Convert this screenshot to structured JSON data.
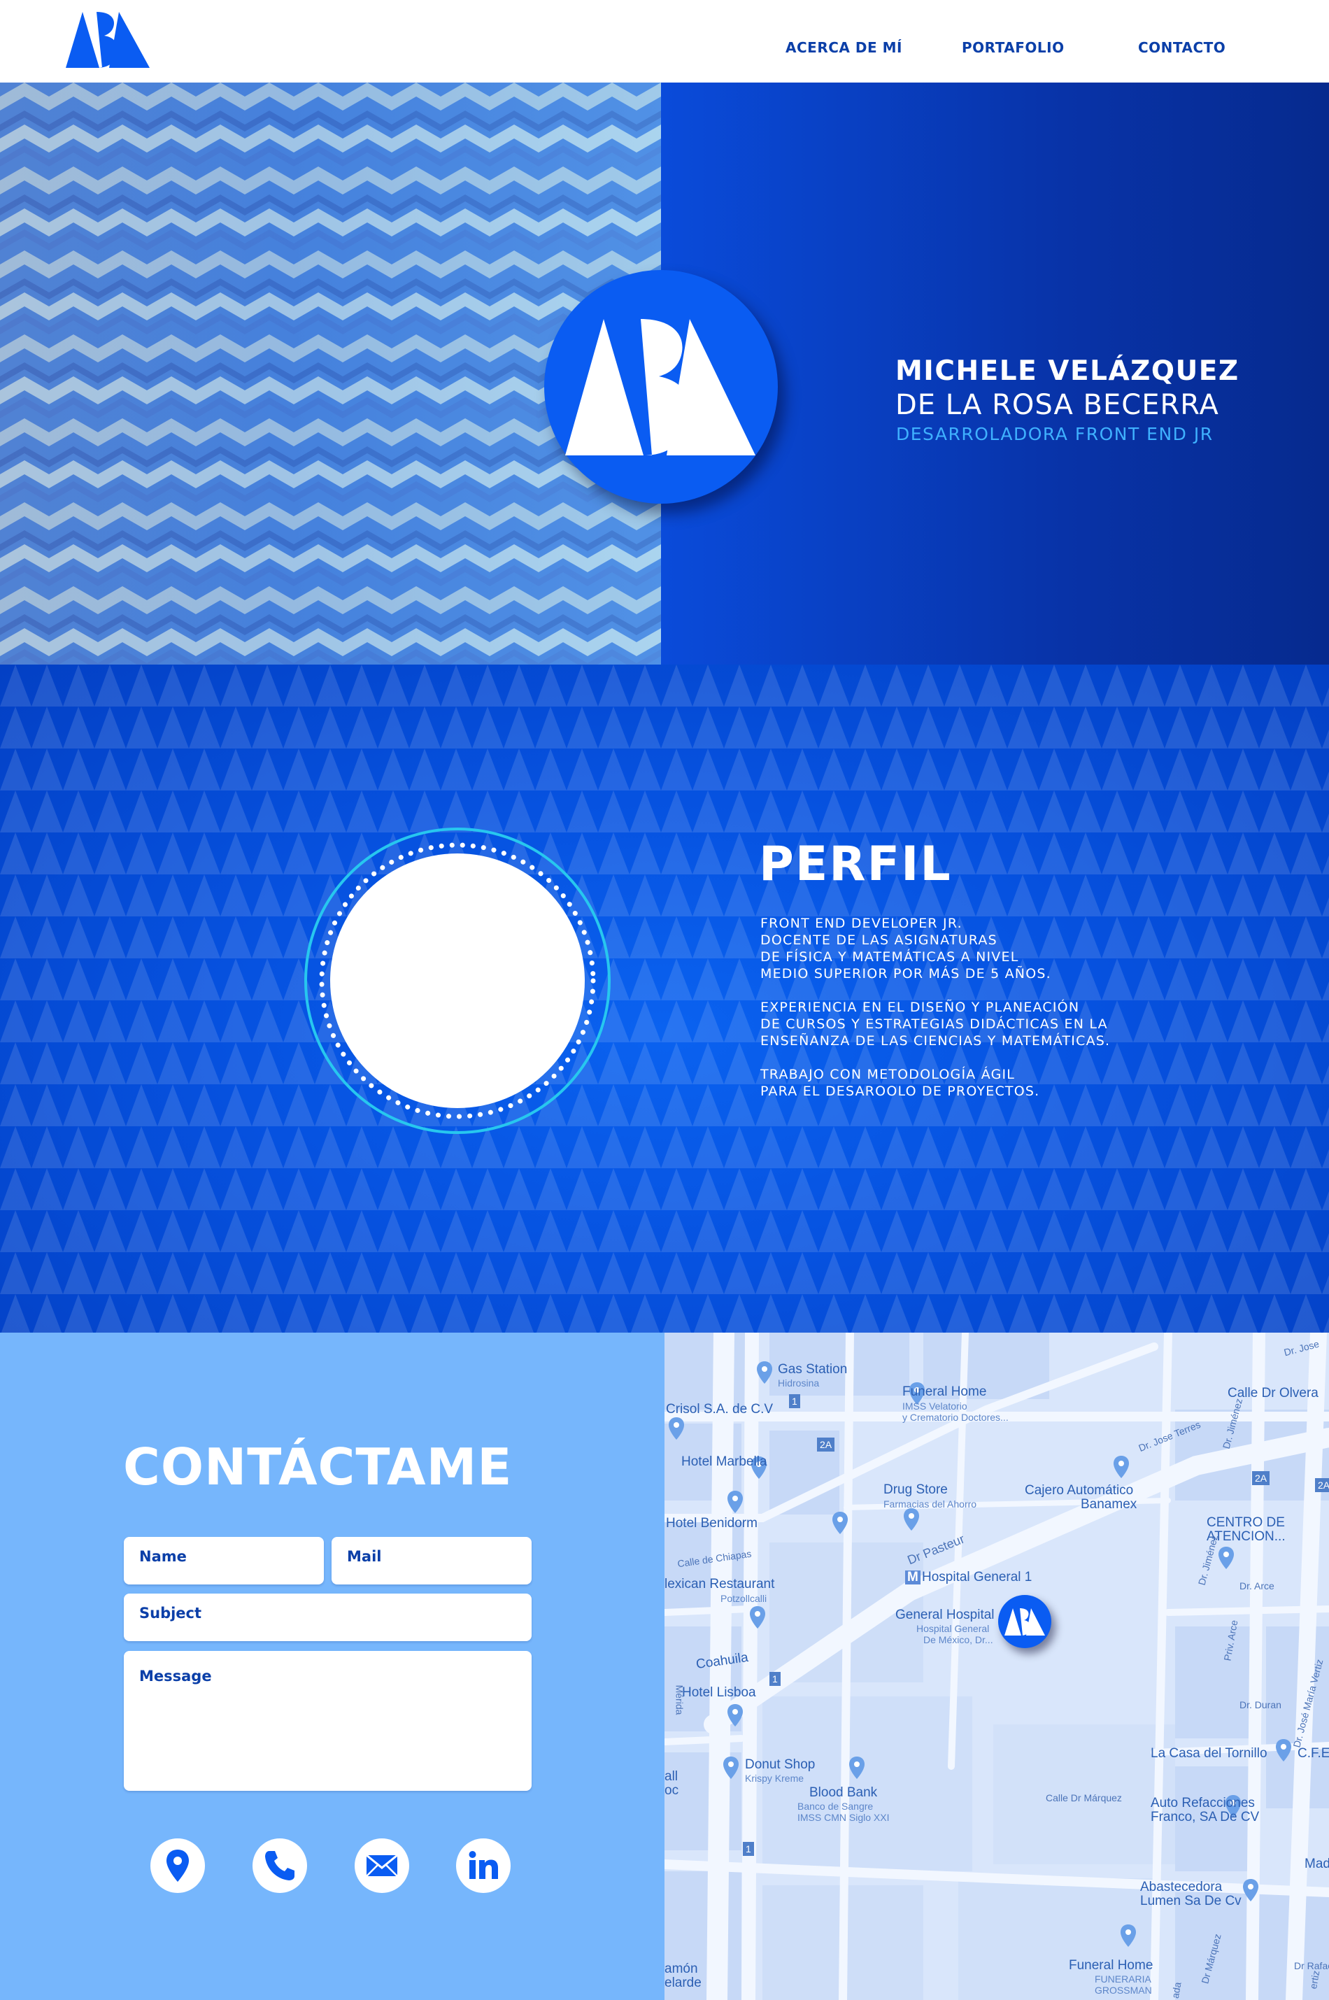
{
  "header": {
    "nav": [
      {
        "label": "ACERCA DE MÍ"
      },
      {
        "label": "PORTAFOLIO"
      },
      {
        "label": "CONTACTO"
      }
    ]
  },
  "hero": {
    "name_line1": "MICHELE VELÁZQUEZ",
    "name_line2": "DE LA ROSA BECERRA",
    "role": "DESARROLADORA FRONT END JR"
  },
  "profile": {
    "title": "PERFIL",
    "paragraphs": [
      "FRONT END DEVELOPER JR.\nDOCENTE DE LAS ASIGNATURAS\nDE FÍSICA Y MATEMÁTICAS A NIVEL\nMEDIO SUPERIOR POR MÁS DE 5 AÑOS.",
      "EXPERIENCIA EN EL DISEÑO Y PLANEACIÓN\nDE CURSOS Y ESTRATEGIAS DIDÁCTICAS EN LA\nENSEÑANZA DE LAS CIENCIAS Y MATEMÁTICAS.",
      "TRABAJO CON METODOLOGÍA ÁGIL\nPARA EL DESAROOLO DE PROYECTOS."
    ]
  },
  "contact": {
    "title": "CONTÁCTAME",
    "fields": {
      "name": "Name",
      "mail": "Mail",
      "subject": "Subject",
      "message": "Message"
    },
    "social_icons": [
      "location-icon",
      "phone-icon",
      "mail-icon",
      "linkedin-icon"
    ]
  },
  "map": {
    "labels": {
      "gas_station": "Gas Station",
      "hidrosina": "Hidrosina",
      "funeral_home": "Funeral Home",
      "imss_velatorio": "IMSS Velatorio",
      "crematorio": "y Crematorio Doctores...",
      "calle_olvera": "Calle Dr Olvera",
      "crisol": "Crisol S.A. de C.V",
      "hotel_marbella": "Hotel Marbella",
      "drug_store": "Drug Store",
      "farmacias": "Farmacias del Ahorro",
      "cajero": "Cajero Automático",
      "banamex": "Banamex",
      "hotel_benidorm": "Hotel Benidorm",
      "centro_de": "CENTRO DE",
      "atencion": "ATENCION...",
      "calle_chiapas": "Calle de Chiapas",
      "dr_pasteur": "Dr Pasteur",
      "hospital_general_1": "Hospital General 1",
      "metro_m": "M",
      "dr_arce_1": "Dr. Arce",
      "mexican_restaurant": "lexican Restaurant",
      "potzollcalli": "Potzollcalli",
      "general_hospital": "General Hospital",
      "hospital_general": "Hospital General",
      "de_mexico": "De México, Dr...",
      "coahuila": "Coahuila",
      "hotel_lisboa": "Hotel Lisboa",
      "merida": "Mérida",
      "dr_duran": "Dr. Duran",
      "dr_jose_maria_vertiz": "Dr. José María Vertiz",
      "la_casa_tornillo": "La Casa del Tornillo",
      "cfe": "C.F.E",
      "donut_shop": "Donut Shop",
      "krispy_kreme": "Krispy Kreme",
      "blood_bank": "Blood Bank",
      "banco_sangre": "Banco de Sangre",
      "imss_cmn": "IMSS CMN Siglo XXI",
      "calle_dr_marquez": "Calle Dr Márquez",
      "auto_refacciones": "Auto Refacciones",
      "franco": "Franco, SA De CV",
      "abastecedora": "Abastecedora",
      "lumen": "Lumen Sa De Cv",
      "funeral_home_2": "Funeral Home",
      "funeraria": "FUNERARIA",
      "grossman": "GROSSMAN",
      "ramon": "amón",
      "velarde": "elarde",
      "dr_jose_terres": "Dr. Jose Terres",
      "dr_jimenez_1": "Dr. Jiménez",
      "dr_jimenez_2": "Dr. Jiménez",
      "dr_jose_top": "Dr. Jose",
      "priv_arce": "Priv. Arce",
      "dr_marquez_2": "Dr Márquez",
      "dr_rafae": "Dr Rafae",
      "mad": "Mad",
      "all": "all",
      "oc": "oc",
      "route_1a": "1",
      "route_2a_1": "2A",
      "route_2a_2": "2A",
      "route_2a_3": "2A",
      "route_1b": "1",
      "route_1c": "1",
      "vertiz_bottom": "ertiz",
      "ada": "ada"
    }
  },
  "colors": {
    "brand_blue": "#0a5cf2",
    "nav_blue": "#0b3fa8",
    "accent_cyan": "#3fb1ff",
    "contact_bg": "#76b6fc"
  }
}
